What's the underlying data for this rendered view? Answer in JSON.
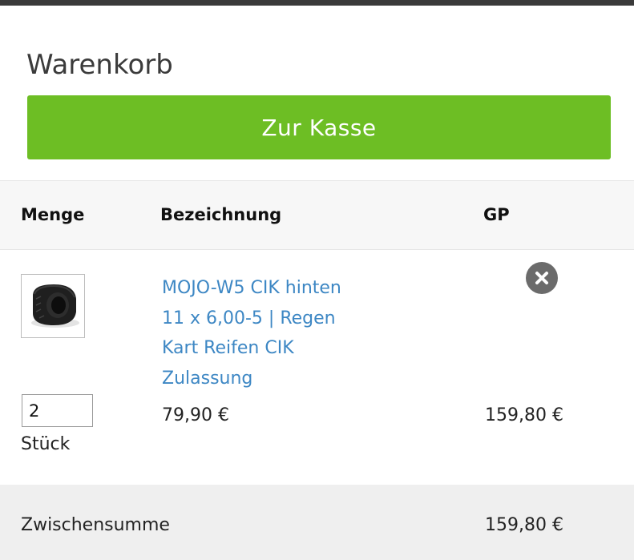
{
  "cart": {
    "title": "Warenkorb",
    "checkout_label": "Zur Kasse"
  },
  "table": {
    "headers": {
      "quantity": "Menge",
      "description": "Bezeichnung",
      "total": "GP"
    }
  },
  "item": {
    "name_lines": [
      "MOJO-W5 CIK hinten",
      "11 x 6,00-5 | Regen",
      "Kart Reifen CIK",
      "Zulassung"
    ],
    "quantity": "2",
    "unit": "Stück",
    "unit_price": "79,90 €",
    "total_price": "159,80 €",
    "remove_icon": "close-circle-icon",
    "thumbnail": "kart-tire-image"
  },
  "subtotal": {
    "label": "Zwischensumme",
    "value": "159,80 €"
  },
  "colors": {
    "checkout": "#6dbe24",
    "link": "#3d87c4",
    "remove": "#6b6b6b",
    "header_bg": "#f7f7f7",
    "subtotal_bg": "#efefef"
  }
}
